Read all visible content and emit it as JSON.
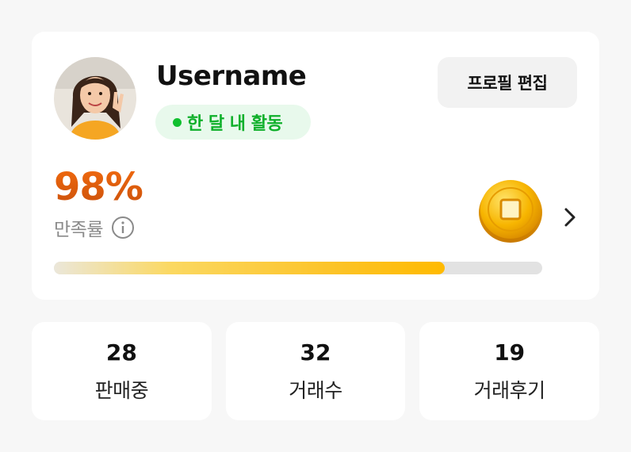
{
  "profile": {
    "username": "Username",
    "activity_badge": "한 달 내 활동",
    "edit_button_label": "프로필 편집",
    "avatar_icon": "user-avatar-photo"
  },
  "satisfaction": {
    "value_text": "98%",
    "label": "만족률",
    "info_icon": "info-icon",
    "coin_icon": "coin-icon",
    "chevron_icon": "chevron-right-icon",
    "progress_percent": 80
  },
  "stats": [
    {
      "value": "28",
      "label": "판매중"
    },
    {
      "value": "32",
      "label": "거래수"
    },
    {
      "value": "19",
      "label": "거래후기"
    }
  ],
  "colors": {
    "background": "#f7f7f7",
    "card": "#ffffff",
    "activity_green": "#10b02b",
    "activity_badge_bg": "#e8f9ec",
    "rate_orange": "#e2620d",
    "progress_yellow": "#ffba00",
    "progress_track": "#e2e2e2"
  }
}
